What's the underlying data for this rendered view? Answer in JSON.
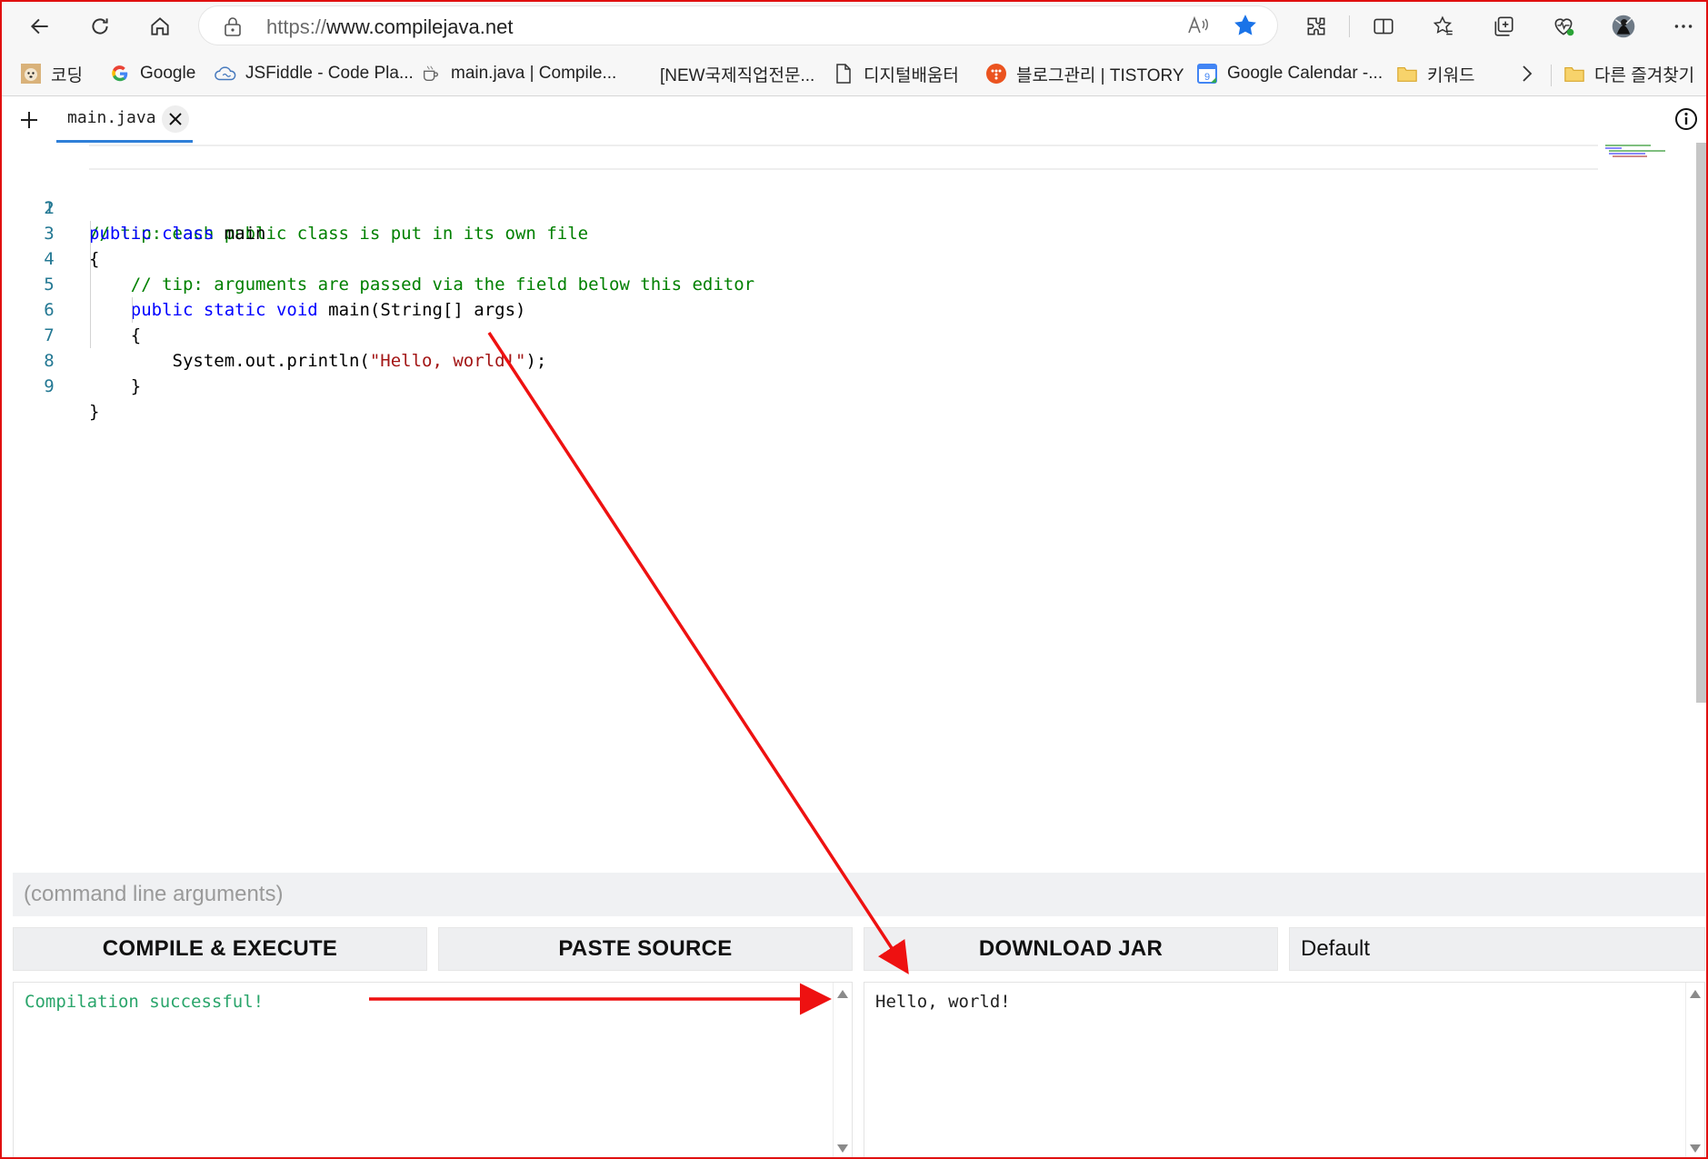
{
  "browser": {
    "url_protocol": "https://",
    "url_host": "www.compilejava.net",
    "read_aloud_label": "A̩",
    "icons": [
      "back-icon",
      "refresh-icon",
      "home-icon",
      "lock-icon",
      "read-aloud-icon",
      "favorite-star-icon",
      "extensions-icon",
      "split-screen-icon",
      "favorites-icon",
      "collections-icon",
      "browser-essentials-icon",
      "profile-avatar",
      "more-icon"
    ]
  },
  "bookmarks": [
    {
      "label": "코딩",
      "icon": "dog-favicon"
    },
    {
      "label": "Google",
      "icon": "google-favicon"
    },
    {
      "label": "JSFiddle - Code Pla...",
      "icon": "jsfiddle-favicon"
    },
    {
      "label": "main.java | Compile...",
      "icon": "coffee-favicon"
    },
    {
      "label": "[NEW국제직업전문...",
      "icon": "blank-favicon"
    },
    {
      "label": "디지털배움터",
      "icon": "document-icon"
    },
    {
      "label": "블로그관리 | TISTORY",
      "icon": "tistory-favicon"
    },
    {
      "label": "Google Calendar -...",
      "icon": "calendar-favicon"
    },
    {
      "label": "키워드",
      "icon": "folder-icon"
    },
    {
      "label": "다른 즐겨찾기",
      "icon": "folder-icon"
    }
  ],
  "editor": {
    "tab_label": "main.java",
    "line_numbers": [
      "1",
      "2",
      "3",
      "4",
      "5",
      "6",
      "7",
      "8",
      "9"
    ],
    "lines": [
      "// tip: each public class is put in its own file",
      "public class main",
      "{",
      "    // tip: arguments are passed via the field below this editor",
      "    public static void main(String[] args)",
      "    {",
      "        System.out.println(\"Hello, world!\");",
      "    }",
      "}"
    ]
  },
  "controls": {
    "args_placeholder": "(command line arguments)",
    "compile_label": "COMPILE & EXECUTE",
    "paste_label": "PASTE SOURCE",
    "download_label": "DOWNLOAD JAR",
    "select_value": "Default"
  },
  "output": {
    "compiler_message": "Compilation successful!",
    "program_output": "Hello, world!"
  },
  "colors": {
    "keyword": "#0000ff",
    "comment": "#008000",
    "string": "#a31515",
    "success": "#2aa56b",
    "annotation_arrow": "#ee1111",
    "tab_underline": "#2f7fd8"
  }
}
